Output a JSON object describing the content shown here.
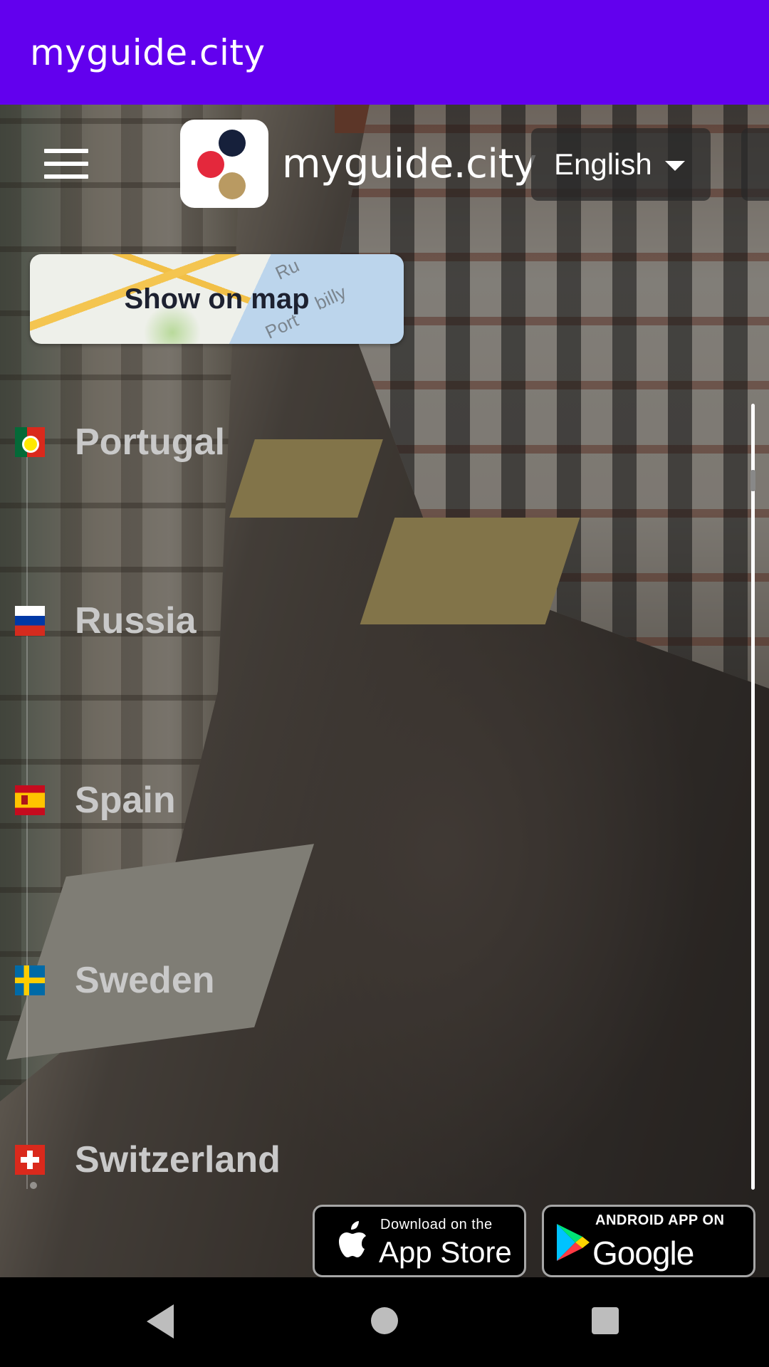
{
  "app_bar": {
    "title": "myguide.city"
  },
  "header": {
    "menu_icon": "hamburger-icon",
    "logo_icon": "myguide-logo-icon",
    "brand": "myguide.city",
    "language": "English",
    "language_caret_icon": "caret-down-icon"
  },
  "map_button": {
    "label": "Show on map",
    "map_text": [
      "Ru",
      "Port",
      "billy"
    ]
  },
  "countries": [
    {
      "name": "Portugal",
      "flag_icon": "portugal-flag-icon"
    },
    {
      "name": "Russia",
      "flag_icon": "russia-flag-icon"
    },
    {
      "name": "Spain",
      "flag_icon": "spain-flag-icon"
    },
    {
      "name": "Sweden",
      "flag_icon": "sweden-flag-icon"
    },
    {
      "name": "Switzerland",
      "flag_icon": "switzerland-flag-icon"
    }
  ],
  "store_badges": {
    "appstore": {
      "small": "Download on the",
      "big": "App Store",
      "icon": "apple-icon"
    },
    "googleplay": {
      "small": "ANDROID APP ON",
      "big": "Google play",
      "icon": "google-play-icon"
    }
  },
  "nav_bar": {
    "back_icon": "back-triangle-icon",
    "home_icon": "home-circle-icon",
    "recents_icon": "recents-square-icon"
  },
  "colors": {
    "app_bar": "#6200ee",
    "country_text": "#c9c9c9",
    "map_label": "#1d2130"
  }
}
